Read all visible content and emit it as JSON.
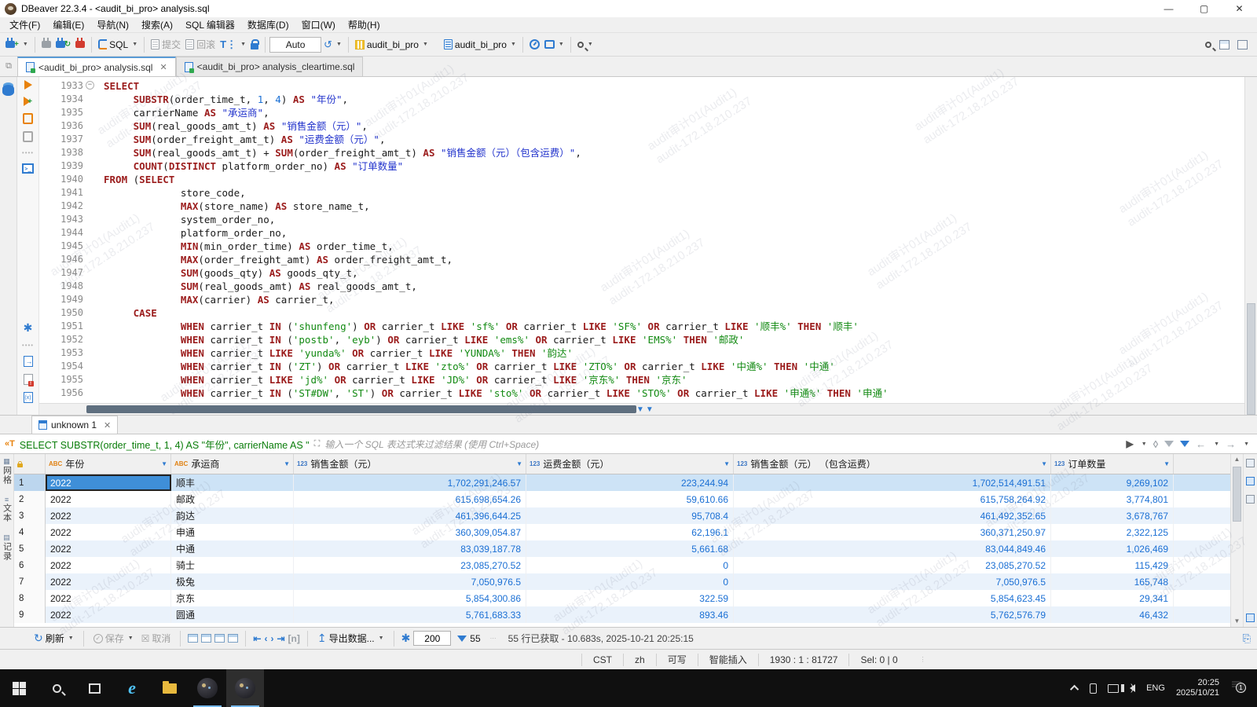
{
  "window": {
    "title": "DBeaver 22.3.4 - <audit_bi_pro> analysis.sql"
  },
  "menu": {
    "items": [
      "文件(F)",
      "编辑(E)",
      "导航(N)",
      "搜索(A)",
      "SQL 编辑器",
      "数据库(D)",
      "窗口(W)",
      "帮助(H)"
    ]
  },
  "toolbar": {
    "sql_label": "SQL",
    "commit_label": "提交",
    "rollback_label": "回滚",
    "autocommit_value": "Auto",
    "connection": "audit_bi_pro",
    "schema": "audit_bi_pro"
  },
  "editor_tabs": [
    {
      "label": "<audit_bi_pro> analysis.sql",
      "active": true,
      "closable": true
    },
    {
      "label": "<audit_bi_pro> analysis_cleartime.sql",
      "active": false,
      "closable": false
    }
  ],
  "editor": {
    "lines": [
      {
        "no": "1933",
        "fold": true,
        "text": "SELECT"
      },
      {
        "no": "1934",
        "text": "     SUBSTR(order_time_t, 1, 4) AS \"年份\","
      },
      {
        "no": "1935",
        "text": "     carrierName AS \"承运商\","
      },
      {
        "no": "1936",
        "text": "     SUM(real_goods_amt_t) AS \"销售金额（元）\","
      },
      {
        "no": "1937",
        "text": "     SUM(order_freight_amt_t) AS \"运费金额（元）\","
      },
      {
        "no": "1938",
        "text": "     SUM(real_goods_amt_t) + SUM(order_freight_amt_t) AS \"销售金额（元）（包含运费）\","
      },
      {
        "no": "1939",
        "text": "     COUNT(DISTINCT platform_order_no) AS \"订单数量\""
      },
      {
        "no": "1940",
        "text": "FROM (SELECT"
      },
      {
        "no": "1941",
        "text": "             store_code,"
      },
      {
        "no": "1942",
        "text": "             MAX(store_name) AS store_name_t,"
      },
      {
        "no": "1943",
        "text": "             system_order_no,"
      },
      {
        "no": "1944",
        "text": "             platform_order_no,"
      },
      {
        "no": "1945",
        "text": "             MIN(min_order_time) AS order_time_t,"
      },
      {
        "no": "1946",
        "text": "             MAX(order_freight_amt) AS order_freight_amt_t,"
      },
      {
        "no": "1947",
        "text": "             SUM(goods_qty) AS goods_qty_t,"
      },
      {
        "no": "1948",
        "text": "             SUM(real_goods_amt) AS real_goods_amt_t,"
      },
      {
        "no": "1949",
        "text": "             MAX(carrier) AS carrier_t,"
      },
      {
        "no": "1950",
        "text": "     CASE"
      },
      {
        "no": "1951",
        "text": "             WHEN carrier_t IN ('shunfeng') OR carrier_t LIKE 'sf%' OR carrier_t LIKE 'SF%' OR carrier_t LIKE '顺丰%' THEN '顺丰'"
      },
      {
        "no": "1952",
        "text": "             WHEN carrier_t IN ('postb', 'eyb') OR carrier_t LIKE 'ems%' OR carrier_t LIKE 'EMS%' THEN '邮政'"
      },
      {
        "no": "1953",
        "text": "             WHEN carrier_t LIKE 'yunda%' OR carrier_t LIKE 'YUNDA%' THEN '韵达'"
      },
      {
        "no": "1954",
        "text": "             WHEN carrier_t IN ('ZT') OR carrier_t LIKE 'zto%' OR carrier_t LIKE 'ZTO%' OR carrier_t LIKE '中通%' THEN '中通'"
      },
      {
        "no": "1955",
        "text": "             WHEN carrier_t LIKE 'jd%' OR carrier_t LIKE 'JD%' OR carrier_t LIKE '京东%' THEN '京东'"
      },
      {
        "no": "1956",
        "text": "             WHEN carrier_t IN ('ST#DW', 'ST') OR carrier_t LIKE 'sto%' OR carrier_t LIKE 'STO%' OR carrier_t LIKE '申通%' THEN '申通'"
      }
    ]
  },
  "results": {
    "tab_label": "unknown 1",
    "filter": {
      "query": "SELECT SUBSTR(order_time_t, 1, 4) AS \"年份\", carrierName AS \"",
      "placeholder": "输入一个 SQL 表达式来过滤结果 (使用 Ctrl+Space)"
    },
    "side_tabs": [
      "网格",
      "文本",
      "记录"
    ],
    "grid": {
      "columns": [
        {
          "type": "ABC",
          "label": "年份"
        },
        {
          "type": "ABC",
          "label": "承运商"
        },
        {
          "type": "123",
          "label": "销售金额（元）"
        },
        {
          "type": "123",
          "label": "运费金额（元）"
        },
        {
          "type": "123",
          "label": "销售金额（元） （包含运费）"
        },
        {
          "type": "123",
          "label": "订单数量"
        }
      ],
      "rows": [
        [
          "2022",
          "顺丰",
          "1,702,291,246.57",
          "223,244.94",
          "1,702,514,491.51",
          "9,269,102"
        ],
        [
          "2022",
          "邮政",
          "615,698,654.26",
          "59,610.66",
          "615,758,264.92",
          "3,774,801"
        ],
        [
          "2022",
          "韵达",
          "461,396,644.25",
          "95,708.4",
          "461,492,352.65",
          "3,678,767"
        ],
        [
          "2022",
          "申通",
          "360,309,054.87",
          "62,196.1",
          "360,371,250.97",
          "2,322,125"
        ],
        [
          "2022",
          "中通",
          "83,039,187.78",
          "5,661.68",
          "83,044,849.46",
          "1,026,469"
        ],
        [
          "2022",
          "骑士",
          "23,085,270.52",
          "0",
          "23,085,270.52",
          "115,429"
        ],
        [
          "2022",
          "极兔",
          "7,050,976.5",
          "0",
          "7,050,976.5",
          "165,748"
        ],
        [
          "2022",
          "京东",
          "5,854,300.86",
          "322.59",
          "5,854,623.45",
          "29,341"
        ],
        [
          "2022",
          "圆通",
          "5,761,683.33",
          "893.46",
          "5,762,576.79",
          "46,432"
        ]
      ]
    },
    "toolbar": {
      "refresh_label": "刷新",
      "save_label": "保存",
      "cancel_label": "取消",
      "export_label": "导出数据...",
      "fetch_size": "200",
      "row_limit": "55",
      "status": "55 行已获取 - 10.683s, 2025-10-21 20:25:15"
    }
  },
  "statusbar": {
    "segments": [
      "CST",
      "zh",
      "可写",
      "智能插入",
      "1930 : 1 : 81727",
      "Sel: 0 | 0"
    ]
  },
  "taskbar": {
    "lang": "ENG",
    "time": "20:25",
    "date": "2025/10/21",
    "badge": "1"
  },
  "watermark": {
    "line1": "audit审计01(Audit1)",
    "line2": "audit-172.18.210.237"
  }
}
